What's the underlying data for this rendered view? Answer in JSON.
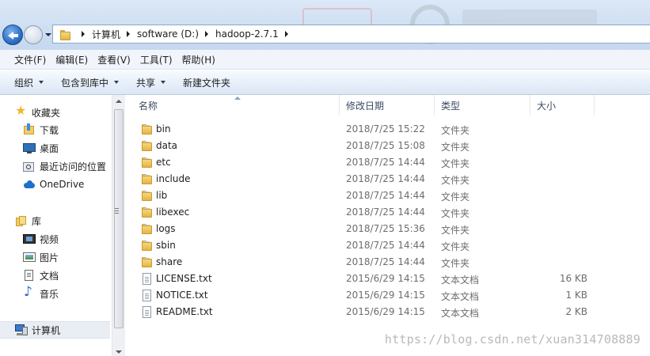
{
  "address": {
    "crumbs": [
      "计算机",
      "software (D:)",
      "hadoop-2.7.1"
    ]
  },
  "menu": [
    "文件(F)",
    "编辑(E)",
    "查看(V)",
    "工具(T)",
    "帮助(H)"
  ],
  "commands": {
    "organize": "组织",
    "include_in_library": "包含到库中",
    "share": "共享",
    "new_folder": "新建文件夹"
  },
  "nav": {
    "favorites": "收藏夹",
    "downloads": "下载",
    "desktop": "桌面",
    "recent": "最近访问的位置",
    "onedrive": "OneDrive",
    "libraries": "库",
    "videos": "视频",
    "pictures": "图片",
    "documents": "文档",
    "music": "音乐",
    "computer": "计算机"
  },
  "columns": {
    "name": "名称",
    "modified": "修改日期",
    "type": "类型",
    "size": "大小"
  },
  "files": [
    {
      "name": "bin",
      "date": "2018/7/25 15:22",
      "type": "文件夹",
      "size": "",
      "icon": "folder-icon"
    },
    {
      "name": "data",
      "date": "2018/7/25 15:08",
      "type": "文件夹",
      "size": "",
      "icon": "folder-icon"
    },
    {
      "name": "etc",
      "date": "2018/7/25 14:44",
      "type": "文件夹",
      "size": "",
      "icon": "folder-icon"
    },
    {
      "name": "include",
      "date": "2018/7/25 14:44",
      "type": "文件夹",
      "size": "",
      "icon": "folder-icon"
    },
    {
      "name": "lib",
      "date": "2018/7/25 14:44",
      "type": "文件夹",
      "size": "",
      "icon": "folder-icon"
    },
    {
      "name": "libexec",
      "date": "2018/7/25 14:44",
      "type": "文件夹",
      "size": "",
      "icon": "folder-icon"
    },
    {
      "name": "logs",
      "date": "2018/7/25 15:36",
      "type": "文件夹",
      "size": "",
      "icon": "folder-icon"
    },
    {
      "name": "sbin",
      "date": "2018/7/25 14:44",
      "type": "文件夹",
      "size": "",
      "icon": "folder-icon"
    },
    {
      "name": "share",
      "date": "2018/7/25 14:44",
      "type": "文件夹",
      "size": "",
      "icon": "folder-icon"
    },
    {
      "name": "LICENSE.txt",
      "date": "2015/6/29 14:15",
      "type": "文本文档",
      "size": "16 KB",
      "icon": "text-file-icon"
    },
    {
      "name": "NOTICE.txt",
      "date": "2015/6/29 14:15",
      "type": "文本文档",
      "size": "1 KB",
      "icon": "text-file-icon"
    },
    {
      "name": "README.txt",
      "date": "2015/6/29 14:15",
      "type": "文本文档",
      "size": "2 KB",
      "icon": "text-file-icon"
    }
  ],
  "watermark": "https://blog.csdn.net/xuan314708889"
}
